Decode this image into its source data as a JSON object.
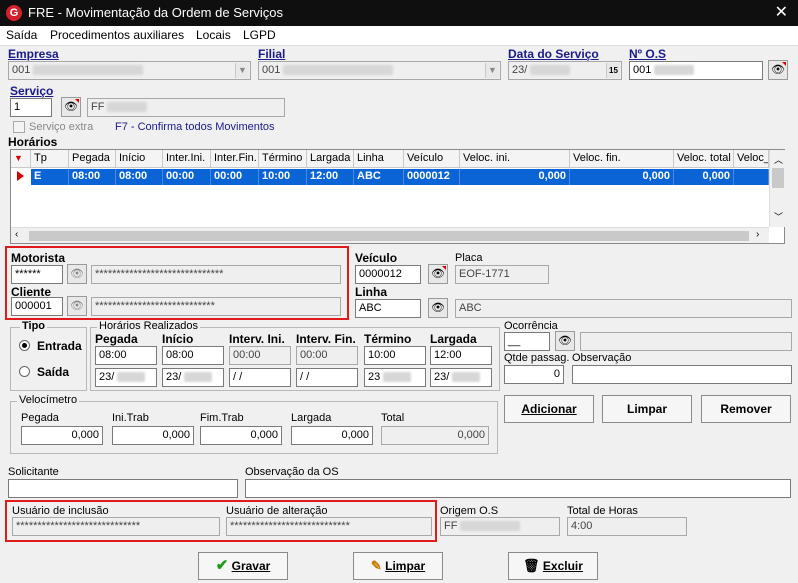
{
  "window": {
    "title": "FRE - Movimentação da Ordem de Serviços",
    "close": "✕",
    "logo": "G"
  },
  "menu": [
    "Saída",
    "Procedimentos auxiliares",
    "Locais",
    "LGPD"
  ],
  "header": {
    "empresa_label": "Empresa",
    "empresa_value": "001",
    "filial_label": "Filial",
    "filial_value": "001",
    "data_label": "Data do Serviço",
    "data_value": "23/",
    "cal_label": "15",
    "os_label": "Nº O.S",
    "os_value": "001"
  },
  "servico": {
    "label": "Serviço",
    "value": "1",
    "desc": "FF",
    "extra_label": "Serviço extra",
    "hint": "F7 - Confirma todos Movimentos"
  },
  "horarios": {
    "label": "Horários",
    "columns": [
      "Tp",
      "Pegada",
      "Início",
      "Inter.Ini.",
      "Inter.Fin.",
      "Término",
      "Largada",
      "Linha",
      "Veículo",
      "Veloc. ini.",
      "Veloc. fin.",
      "Veloc. total",
      "Veloc_Fi"
    ],
    "row": [
      "E",
      "08:00",
      "08:00",
      "00:00",
      "00:00",
      "10:00",
      "12:00",
      "ABC",
      "0000012",
      "0,000",
      "0,000",
      "0,000",
      ""
    ]
  },
  "motorista": {
    "label": "Motorista",
    "code": "******",
    "name": "******************************"
  },
  "cliente": {
    "label": "Cliente",
    "code": "000001",
    "name": "****************************"
  },
  "veiculo": {
    "label": "Veículo",
    "value": "0000012",
    "placa_label": "Placa",
    "placa_value": "EOF-1771"
  },
  "linha": {
    "label": "Linha",
    "value": "ABC",
    "desc": "ABC"
  },
  "tipo": {
    "label": "Tipo",
    "entrada": "Entrada",
    "saida": "Saída"
  },
  "realizados": {
    "label": "Horários Realizados",
    "cols": [
      "Pegada",
      "Início",
      "Interv. Ini.",
      "Interv. Fin.",
      "Término",
      "Largada"
    ],
    "times": [
      "08:00",
      "08:00",
      "00:00",
      "00:00",
      "10:00",
      "12:00"
    ],
    "dates": [
      "23/",
      "23/",
      " /  /",
      " /  /",
      "23",
      "23/"
    ]
  },
  "ocorrencia": {
    "label": "Ocorrência",
    "value": "__"
  },
  "qtde": {
    "label": "Qtde passag.",
    "value": "0"
  },
  "observacao": {
    "label": "Observação"
  },
  "velocimetro": {
    "label": "Velocímetro",
    "cols": [
      "Pegada",
      "Ini.Trab",
      "Fim.Trab",
      "Largada",
      "Total"
    ],
    "values": [
      "0,000",
      "0,000",
      "0,000",
      "0,000",
      "0,000"
    ]
  },
  "actions": {
    "adicionar": "Adicionar",
    "limpar": "Limpar",
    "remover": "Remover"
  },
  "solicitante": {
    "label": "Solicitante"
  },
  "obs_os": {
    "label": "Observação da OS"
  },
  "usuario_inclusao": {
    "label": "Usuário de inclusão",
    "value": "*****************************"
  },
  "usuario_alteracao": {
    "label": "Usuário de alteração",
    "value": "****************************"
  },
  "origem_os": {
    "label": "Origem O.S",
    "value": "FF"
  },
  "total_horas": {
    "label": "Total de Horas",
    "value": "4:00"
  },
  "footer": {
    "gravar": "Gravar",
    "limpar": "Limpar",
    "excluir": "Excluir"
  },
  "colors": {
    "accent": "#0a64d6",
    "highlight_box": "#e01b1b",
    "label_blue": "#1a1a8a"
  }
}
